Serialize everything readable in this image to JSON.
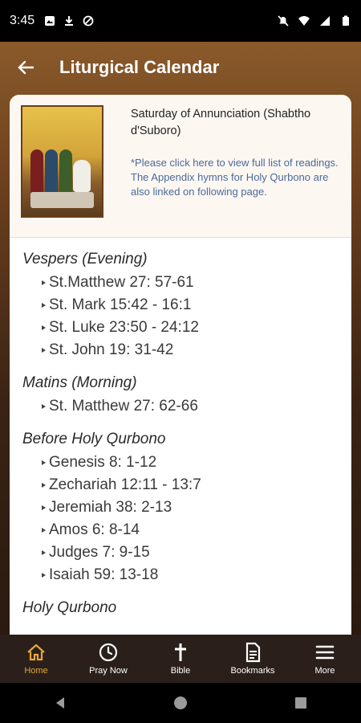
{
  "status_bar": {
    "time": "3:45"
  },
  "app_bar": {
    "title": "Liturgical Calendar"
  },
  "header": {
    "title": "Saturday of Annunciation (Shabtho d'Suboro)",
    "note": "*Please click here to view full list of readings. The Appendix hymns for Holy Qurbono are also linked on following page."
  },
  "sections": [
    {
      "title": "Vespers (Evening)",
      "items": [
        "St.Matthew 27: 57-61",
        "St. Mark 15:42 - 16:1",
        "St. Luke 23:50 - 24:12",
        "St. John 19: 31-42"
      ]
    },
    {
      "title": "Matins (Morning)",
      "items": [
        "St. Matthew 27: 62-66"
      ]
    },
    {
      "title": "Before Holy Qurbono",
      "items": [
        "Genesis 8: 1-12",
        "Zechariah 12:11 - 13:7",
        "Jeremiah 38: 2-13",
        "Amos 6: 8-14",
        "Judges 7: 9-15",
        "Isaiah 59: 13-18"
      ]
    },
    {
      "title": "Holy Qurbono",
      "items": []
    }
  ],
  "bottom_nav": [
    {
      "label": "Home",
      "icon": "home-icon",
      "active": true
    },
    {
      "label": "Pray Now",
      "icon": "clock-icon",
      "active": false
    },
    {
      "label": "Bible",
      "icon": "cross-icon",
      "active": false
    },
    {
      "label": "Bookmarks",
      "icon": "document-icon",
      "active": false
    },
    {
      "label": "More",
      "icon": "menu-icon",
      "active": false
    }
  ],
  "colors": {
    "accent": "#e5a73a",
    "nav_bg": "#2a1f1a",
    "note_text": "#4a6a9a"
  }
}
